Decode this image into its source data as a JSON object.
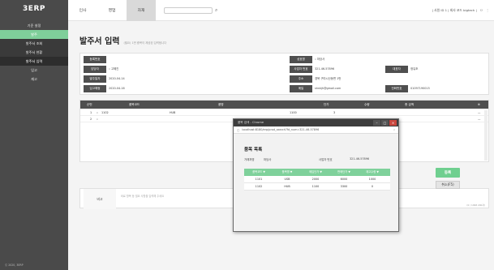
{
  "app": {
    "logo": "3ERP"
  },
  "sidebar": {
    "items": [
      {
        "label": "기준 설정"
      },
      {
        "label": "발주"
      },
      {
        "label": "발주서 조회"
      },
      {
        "label": "발주서 현황"
      },
      {
        "label": "발주서 입력"
      },
      {
        "label": "입고"
      },
      {
        "label": "재고"
      }
    ],
    "footer": "Ⓒ 2020, 3ERP"
  },
  "topbar": {
    "tabs": [
      "인사",
      "영업",
      "자재"
    ],
    "user_info": "| 사원 ID 1 | 회사 코드 bigtech |"
  },
  "page": {
    "title": "발주서 입력",
    "subtitle": "(필요) 1번 중복이 제공된 입력됩니다"
  },
  "form": {
    "reg_no_label": "등록번호",
    "reg_no_value": "",
    "owner_label": "담당자",
    "owner_value": "고혜진",
    "order_date_label": "발주일자",
    "order_date_value": "2020-04-14",
    "due_date_label": "입고예정",
    "due_date_value": "2020-04-16",
    "trade_name_label": "상호명",
    "trade_name_value": "마당사",
    "biz_no_label": "사업자 번호",
    "biz_no_value": "321-46-57896",
    "ceo_label": "대표자",
    "ceo_value": "정유조",
    "address_label": "주소",
    "address_value": "경북 구미시산동면 1번",
    "email_label": "메일",
    "email_value": "shnkjh@gmail.com",
    "phone_label": "전화번호",
    "phone_value": "01097190015"
  },
  "items_table": {
    "headers": [
      "순번",
      "품목코드",
      "품명",
      "단가",
      "수량",
      "총 금액"
    ],
    "rows": [
      {
        "no": "1",
        "code": "1102",
        "name": "HUB",
        "price": "1100",
        "qty": "3",
        "total": ""
      },
      {
        "no": "2",
        "code": "",
        "name": "",
        "price": "",
        "qty": "",
        "total": ""
      }
    ]
  },
  "memo": {
    "label": "비고",
    "placeholder": "비료 항목 등 필요 사항을 입력해 주세요",
    "count": "(0 / 1098 200자)"
  },
  "buttons": {
    "register": "등록",
    "cancel": "취소(F5)"
  },
  "popup": {
    "window_title": "품목 검색 - Chrome",
    "url": "localhost:8180/erp/prod_search?fd_num=321-46-57896",
    "heading": "품목 목록",
    "vendor_label": "거래처명",
    "vendor_value": "마당사",
    "biz_label": "사업자 번호",
    "biz_value": "321-46-57896",
    "headers": [
      "품목코드 ▼",
      "품목명 ▼",
      "매입단가 ▼",
      "판매단가 ▼",
      "재고수량 ▼"
    ],
    "rows": [
      {
        "code": "1101",
        "name": "USB",
        "buy": "2000",
        "sell": "6000",
        "stock": "1000"
      },
      {
        "code": "1102",
        "name": "HUB",
        "buy": "1100",
        "sell": "3300",
        "stock": "0"
      }
    ]
  },
  "colors": {
    "accent": "#7fcf9a",
    "sidebar": "#4a4a4a",
    "header": "#4f4f4f"
  }
}
